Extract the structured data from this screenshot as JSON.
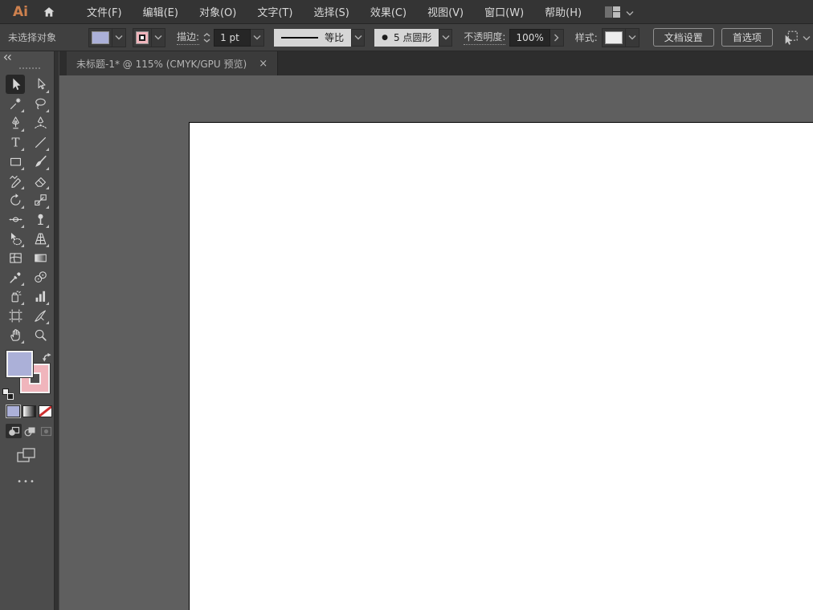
{
  "app": {
    "logo_text": "Ai",
    "colors": {
      "logo": "#ce814e",
      "fill_swatch": "#abb0d8",
      "stroke_swatch": "#f0b5bc",
      "none_red": "#cc2e2e",
      "pasteboard": "#5f5f5f"
    }
  },
  "menubar": {
    "items": [
      "文件(F)",
      "编辑(E)",
      "对象(O)",
      "文字(T)",
      "选择(S)",
      "效果(C)",
      "视图(V)",
      "窗口(W)",
      "帮助(H)"
    ]
  },
  "control_bar": {
    "status_text": "未选择对象",
    "stroke_label": "描边:",
    "stroke_weight_value": "1 pt",
    "variable_width_profile": "等比",
    "brush_bullet": "●",
    "brush_definition": "5 点圆形",
    "opacity_label": "不透明度:",
    "opacity_value": "100%",
    "style_label": "样式:",
    "document_setup_button": "文档设置",
    "preferences_button": "首选项"
  },
  "tabbar": {
    "tabs": [
      {
        "title": "未标题-1* @ 115% (CMYK/GPU 预览)",
        "close_glyph": "×",
        "active": true
      }
    ]
  },
  "toolbar": {
    "more_glyph": "•••",
    "tools": [
      {
        "name": "selection",
        "selected": true,
        "flyout": false
      },
      {
        "name": "direct-selection",
        "selected": false,
        "flyout": true
      },
      {
        "name": "magic-wand",
        "selected": false,
        "flyout": true
      },
      {
        "name": "lasso",
        "selected": false,
        "flyout": true
      },
      {
        "name": "pen",
        "selected": false,
        "flyout": true
      },
      {
        "name": "curvature",
        "selected": false,
        "flyout": false
      },
      {
        "name": "type",
        "selected": false,
        "flyout": true
      },
      {
        "name": "line-segment",
        "selected": false,
        "flyout": true
      },
      {
        "name": "rectangle",
        "selected": false,
        "flyout": true
      },
      {
        "name": "paintbrush",
        "selected": false,
        "flyout": true
      },
      {
        "name": "shaper",
        "selected": false,
        "flyout": true
      },
      {
        "name": "eraser",
        "selected": false,
        "flyout": true
      },
      {
        "name": "rotate",
        "selected": false,
        "flyout": true
      },
      {
        "name": "scale",
        "selected": false,
        "flyout": true
      },
      {
        "name": "width",
        "selected": false,
        "flyout": true
      },
      {
        "name": "puppet-warp",
        "selected": false,
        "flyout": true
      },
      {
        "name": "shape-builder",
        "selected": false,
        "flyout": true
      },
      {
        "name": "perspective-grid",
        "selected": false,
        "flyout": true
      },
      {
        "name": "mesh",
        "selected": false,
        "flyout": false
      },
      {
        "name": "gradient",
        "selected": false,
        "flyout": false
      },
      {
        "name": "eyedropper",
        "selected": false,
        "flyout": true
      },
      {
        "name": "blend",
        "selected": false,
        "flyout": false
      },
      {
        "name": "symbol-sprayer",
        "selected": false,
        "flyout": true
      },
      {
        "name": "column-graph",
        "selected": false,
        "flyout": true
      },
      {
        "name": "artboard",
        "selected": false,
        "flyout": false
      },
      {
        "name": "slice",
        "selected": false,
        "flyout": true
      },
      {
        "name": "hand",
        "selected": false,
        "flyout": true
      },
      {
        "name": "zoom",
        "selected": false,
        "flyout": false
      }
    ]
  }
}
